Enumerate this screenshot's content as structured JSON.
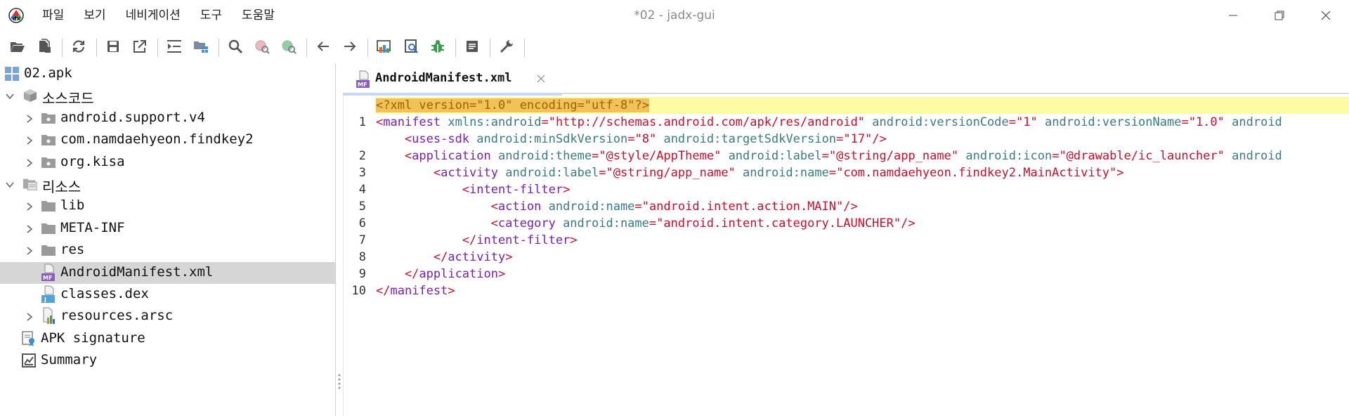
{
  "window": {
    "title": "*02 - jadx-gui",
    "logo_icon": "jadx-logo-icon"
  },
  "menu": [
    "파일",
    "보기",
    "네비게이션",
    "도구",
    "도움말"
  ],
  "toolbar": {
    "icons": [
      "open-folder-icon",
      "add-files-icon",
      "sep",
      "sync-icon",
      "sep",
      "save-icon",
      "export-icon",
      "sep",
      "sync-with-editor-icon",
      "flatten-packages-icon",
      "sep",
      "search-icon",
      "find-usage-icon",
      "find-class-icon",
      "sep",
      "back-arrow-icon",
      "forward-arrow-icon",
      "sep",
      "decompile-all-icon",
      "quark-icon",
      "debug-bug-icon",
      "sep",
      "log-viewer-icon",
      "sep",
      "preferences-wrench-icon",
      "sep"
    ]
  },
  "tree": {
    "items": [
      {
        "label": "02.apk",
        "level": 0,
        "icon": "apk-icon",
        "chevron": "none"
      },
      {
        "label": "소스코드",
        "level": 0,
        "icon": "source-code-icon",
        "chevron": "down"
      },
      {
        "label": "android.support.v4",
        "level": 1,
        "icon": "package-icon",
        "chevron": "right"
      },
      {
        "label": "com.namdaehyeon.findkey2",
        "level": 1,
        "icon": "package-icon",
        "chevron": "right"
      },
      {
        "label": "org.kisa",
        "level": 1,
        "icon": "package-icon",
        "chevron": "right"
      },
      {
        "label": "리소스",
        "level": 0,
        "icon": "resources-icon",
        "chevron": "down"
      },
      {
        "label": "lib",
        "level": 1,
        "icon": "folder-icon",
        "chevron": "right"
      },
      {
        "label": "META-INF",
        "level": 1,
        "icon": "folder-icon",
        "chevron": "right"
      },
      {
        "label": "res",
        "level": 1,
        "icon": "folder-icon",
        "chevron": "right"
      },
      {
        "label": "AndroidManifest.xml",
        "level": 1,
        "icon": "manifest-file-icon",
        "chevron": "none",
        "selected": true
      },
      {
        "label": "classes.dex",
        "level": 1,
        "icon": "dex-file-icon",
        "chevron": "none"
      },
      {
        "label": "resources.arsc",
        "level": 1,
        "icon": "arsc-file-icon",
        "chevron": "right"
      },
      {
        "label": "APK signature",
        "level": 0,
        "icon": "certificate-icon",
        "chevron": "none"
      },
      {
        "label": "Summary",
        "level": 0,
        "icon": "summary-icon",
        "chevron": "none"
      }
    ]
  },
  "editor": {
    "tab": {
      "label": "AndroidManifest.xml",
      "icon": "manifest-file-icon",
      "close_icon": "close-icon"
    },
    "lines": [
      {
        "num": "",
        "highlight": true,
        "segments": [
          [
            "declbg",
            "<?xml version=\"1.0\" encoding=\"utf-8\"?>"
          ]
        ]
      },
      {
        "num": "1",
        "segments": [
          [
            "punct",
            "<"
          ],
          [
            "tag",
            "manifest"
          ],
          [
            "plain",
            " "
          ],
          [
            "attr",
            "xmlns:android"
          ],
          [
            "punct",
            "="
          ],
          [
            "str",
            "\"http://schemas.android.com/apk/res/android\""
          ],
          [
            "plain",
            " "
          ],
          [
            "attr",
            "android:versionCode"
          ],
          [
            "punct",
            "="
          ],
          [
            "str",
            "\"1\""
          ],
          [
            "plain",
            " "
          ],
          [
            "attr",
            "android:versionName"
          ],
          [
            "punct",
            "="
          ],
          [
            "str",
            "\"1.0\""
          ],
          [
            "plain",
            " "
          ],
          [
            "attr",
            "android"
          ]
        ]
      },
      {
        "num": "",
        "indent": 4,
        "segments": [
          [
            "punct",
            "<"
          ],
          [
            "tag",
            "uses-sdk"
          ],
          [
            "plain",
            " "
          ],
          [
            "attr",
            "android:minSdkVersion"
          ],
          [
            "punct",
            "="
          ],
          [
            "str",
            "\"8\""
          ],
          [
            "plain",
            " "
          ],
          [
            "attr",
            "android:targetSdkVersion"
          ],
          [
            "punct",
            "="
          ],
          [
            "str",
            "\"17\""
          ],
          [
            "punct",
            "/>"
          ]
        ]
      },
      {
        "num": "2",
        "indent": 4,
        "segments": [
          [
            "punct",
            "<"
          ],
          [
            "tag",
            "application"
          ],
          [
            "plain",
            " "
          ],
          [
            "attr",
            "android:theme"
          ],
          [
            "punct",
            "="
          ],
          [
            "str",
            "\"@style/AppTheme\""
          ],
          [
            "plain",
            " "
          ],
          [
            "attr",
            "android:label"
          ],
          [
            "punct",
            "="
          ],
          [
            "str",
            "\"@string/app_name\""
          ],
          [
            "plain",
            " "
          ],
          [
            "attr",
            "android:icon"
          ],
          [
            "punct",
            "="
          ],
          [
            "str",
            "\"@drawable/ic_launcher\""
          ],
          [
            "plain",
            " "
          ],
          [
            "attr",
            "android"
          ]
        ]
      },
      {
        "num": "3",
        "indent": 8,
        "segments": [
          [
            "punct",
            "<"
          ],
          [
            "tag",
            "activity"
          ],
          [
            "plain",
            " "
          ],
          [
            "attr",
            "android:label"
          ],
          [
            "punct",
            "="
          ],
          [
            "str",
            "\"@string/app_name\""
          ],
          [
            "plain",
            " "
          ],
          [
            "attr",
            "android:name"
          ],
          [
            "punct",
            "="
          ],
          [
            "str",
            "\"com.namdaehyeon.findkey2.MainActivity\""
          ],
          [
            "punct",
            ">"
          ]
        ]
      },
      {
        "num": "4",
        "indent": 12,
        "segments": [
          [
            "punct",
            "<"
          ],
          [
            "tag",
            "intent-filter"
          ],
          [
            "punct",
            ">"
          ]
        ]
      },
      {
        "num": "5",
        "indent": 16,
        "segments": [
          [
            "punct",
            "<"
          ],
          [
            "tag",
            "action"
          ],
          [
            "plain",
            " "
          ],
          [
            "attr",
            "android:name"
          ],
          [
            "punct",
            "="
          ],
          [
            "str",
            "\"android.intent.action.MAIN\""
          ],
          [
            "punct",
            "/>"
          ]
        ]
      },
      {
        "num": "6",
        "indent": 16,
        "segments": [
          [
            "punct",
            "<"
          ],
          [
            "tag",
            "category"
          ],
          [
            "plain",
            " "
          ],
          [
            "attr",
            "android:name"
          ],
          [
            "punct",
            "="
          ],
          [
            "str",
            "\"android.intent.category.LAUNCHER\""
          ],
          [
            "punct",
            "/>"
          ]
        ]
      },
      {
        "num": "7",
        "indent": 12,
        "segments": [
          [
            "punct",
            "</"
          ],
          [
            "tag",
            "intent-filter"
          ],
          [
            "punct",
            ">"
          ]
        ]
      },
      {
        "num": "8",
        "indent": 8,
        "segments": [
          [
            "punct",
            "</"
          ],
          [
            "tag",
            "activity"
          ],
          [
            "punct",
            ">"
          ]
        ]
      },
      {
        "num": "9",
        "indent": 4,
        "segments": [
          [
            "punct",
            "</"
          ],
          [
            "tag",
            "application"
          ],
          [
            "punct",
            ">"
          ]
        ]
      },
      {
        "num": "10",
        "indent": 0,
        "segments": [
          [
            "punct",
            "</"
          ],
          [
            "tag",
            "manifest"
          ],
          [
            "punct",
            ">"
          ]
        ]
      }
    ]
  },
  "colors": {
    "tag": "#7a1fb0",
    "attr": "#3a7a84",
    "string": "#c8102e",
    "highlight_line": "#fdfba4",
    "selection": "#d6d6d6"
  }
}
